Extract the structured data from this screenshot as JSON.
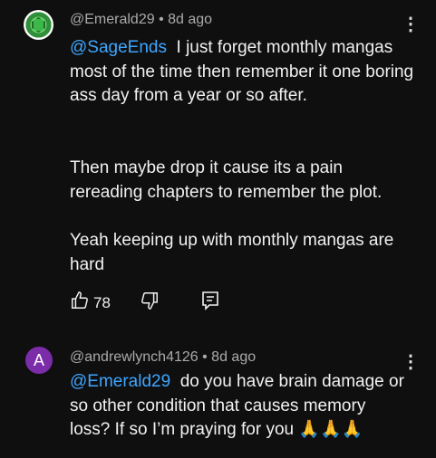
{
  "comments": [
    {
      "author": "@Emerald29",
      "time": "8d ago",
      "mention": "@SageEnds",
      "paragraphs": [
        "I just forget monthly mangas most of the time then remember it one boring ass day from a year or so after.",
        "Then maybe drop it cause its a pain rereading chapters to remember the plot.",
        "Yeah keeping up with monthly mangas are hard"
      ],
      "likes": "78",
      "menu_icon": "vertical-dots-icon"
    },
    {
      "author": "@andrewlynch4126",
      "time": "8d ago",
      "avatar_letter": "A",
      "avatar_color": "#7b2ca8",
      "mention": "@Emerald29",
      "text": "do you have brain damage or so other condition that causes memory loss? If so I’m praying for you",
      "emoji": "🙏🙏🙏",
      "menu_icon": "vertical-dots-icon"
    }
  ],
  "colors": {
    "background": "#0f0f0f",
    "mention": "#3ea6ff",
    "meta": "#aaaaaa"
  }
}
